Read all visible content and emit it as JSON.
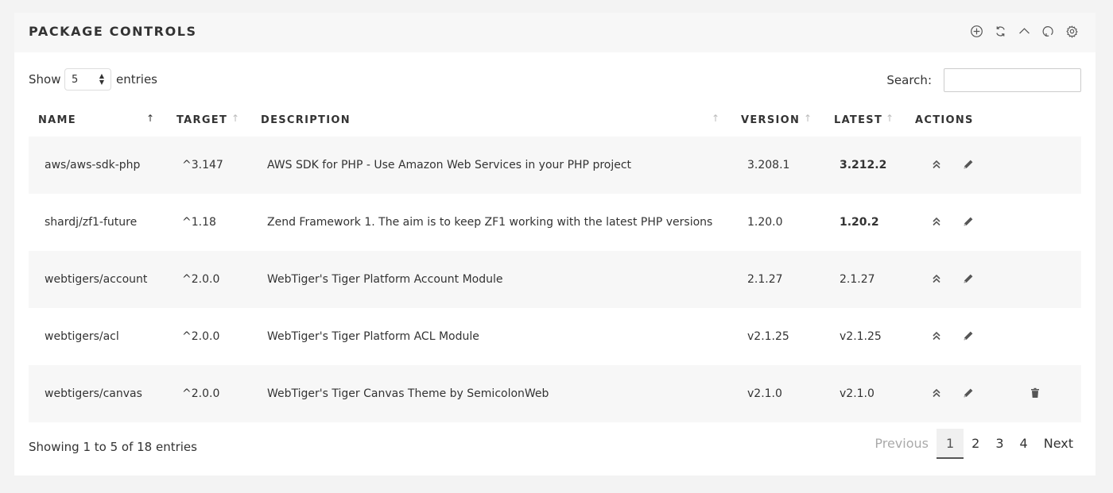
{
  "panel": {
    "title": "PACKAGE CONTROLS"
  },
  "header_icons": [
    "plus-circle-icon",
    "refresh-icon",
    "chevron-up-icon",
    "reload-icon",
    "gear-icon"
  ],
  "controls": {
    "show_label": "Show",
    "show_value": "5",
    "entries_label": "entries",
    "search_label": "Search:",
    "search_value": "",
    "search_placeholder": ""
  },
  "table": {
    "headers": {
      "name": "NAME",
      "target": "TARGET",
      "description": "DESCRIPTION",
      "version": "VERSION",
      "latest": "LATEST",
      "actions": "ACTIONS"
    },
    "rows": [
      {
        "name": "aws/aws-sdk-php",
        "target": "^3.147",
        "description": "AWS SDK for PHP - Use Amazon Web Services in your PHP project",
        "version": "3.208.1",
        "latest": "3.212.2",
        "latest_bold": true,
        "deletable": false
      },
      {
        "name": "shardj/zf1-future",
        "target": "^1.18",
        "description": "Zend Framework 1. The aim is to keep ZF1 working with the latest PHP versions",
        "version": "1.20.0",
        "latest": "1.20.2",
        "latest_bold": true,
        "deletable": false
      },
      {
        "name": "webtigers/account",
        "target": "^2.0.0",
        "description": "WebTiger's Tiger Platform Account Module",
        "version": "2.1.27",
        "latest": "2.1.27",
        "latest_bold": false,
        "deletable": false
      },
      {
        "name": "webtigers/acl",
        "target": "^2.0.0",
        "description": "WebTiger's Tiger Platform ACL Module",
        "version": "v2.1.25",
        "latest": "v2.1.25",
        "latest_bold": false,
        "deletable": false
      },
      {
        "name": "webtigers/canvas",
        "target": "^2.0.0",
        "description": "WebTiger's Tiger Canvas Theme by SemicolonWeb",
        "version": "v2.1.0",
        "latest": "v2.1.0",
        "latest_bold": false,
        "deletable": true
      }
    ]
  },
  "footer": {
    "info": "Showing 1 to 5 of 18 entries",
    "pagination": {
      "previous": "Previous",
      "pages": [
        "1",
        "2",
        "3",
        "4"
      ],
      "current": "1",
      "next": "Next"
    }
  }
}
